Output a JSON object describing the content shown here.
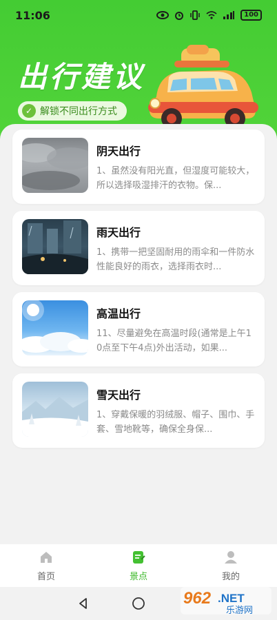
{
  "status": {
    "time": "11:06",
    "battery": "100"
  },
  "hero": {
    "title": "出行建议",
    "pill_text": "解锁不同出行方式"
  },
  "cards": [
    {
      "title": "阴天出行",
      "desc": "1、虽然没有阳光直，但湿度可能较大，所以选择吸湿排汗的衣物。保...",
      "image": "overcast-sky"
    },
    {
      "title": "雨天出行",
      "desc": "1、携带一把坚固耐用的雨伞和一件防水性能良好的雨衣，选择雨衣时...",
      "image": "rainy-street"
    },
    {
      "title": "高温出行",
      "desc": "11、尽量避免在高温时段(通常是上午10点至下午4点)外出活动，如果...",
      "image": "sunny-sky"
    },
    {
      "title": "雪天出行",
      "desc": "1、穿戴保暖的羽绒服、帽子、围巾、手套、雪地靴等，确保全身保...",
      "image": "snow-landscape"
    }
  ],
  "tabs": [
    {
      "label": "首页",
      "icon": "home-icon",
      "active": false
    },
    {
      "label": "景点",
      "icon": "note-icon",
      "active": true
    },
    {
      "label": "我的",
      "icon": "profile-icon",
      "active": false
    }
  ],
  "watermark": {
    "brand": "962",
    "suffix": ".NET",
    "sub": "乐游网"
  },
  "colors": {
    "brand_green": "#44cc33",
    "active_tab": "#3cb82a"
  }
}
